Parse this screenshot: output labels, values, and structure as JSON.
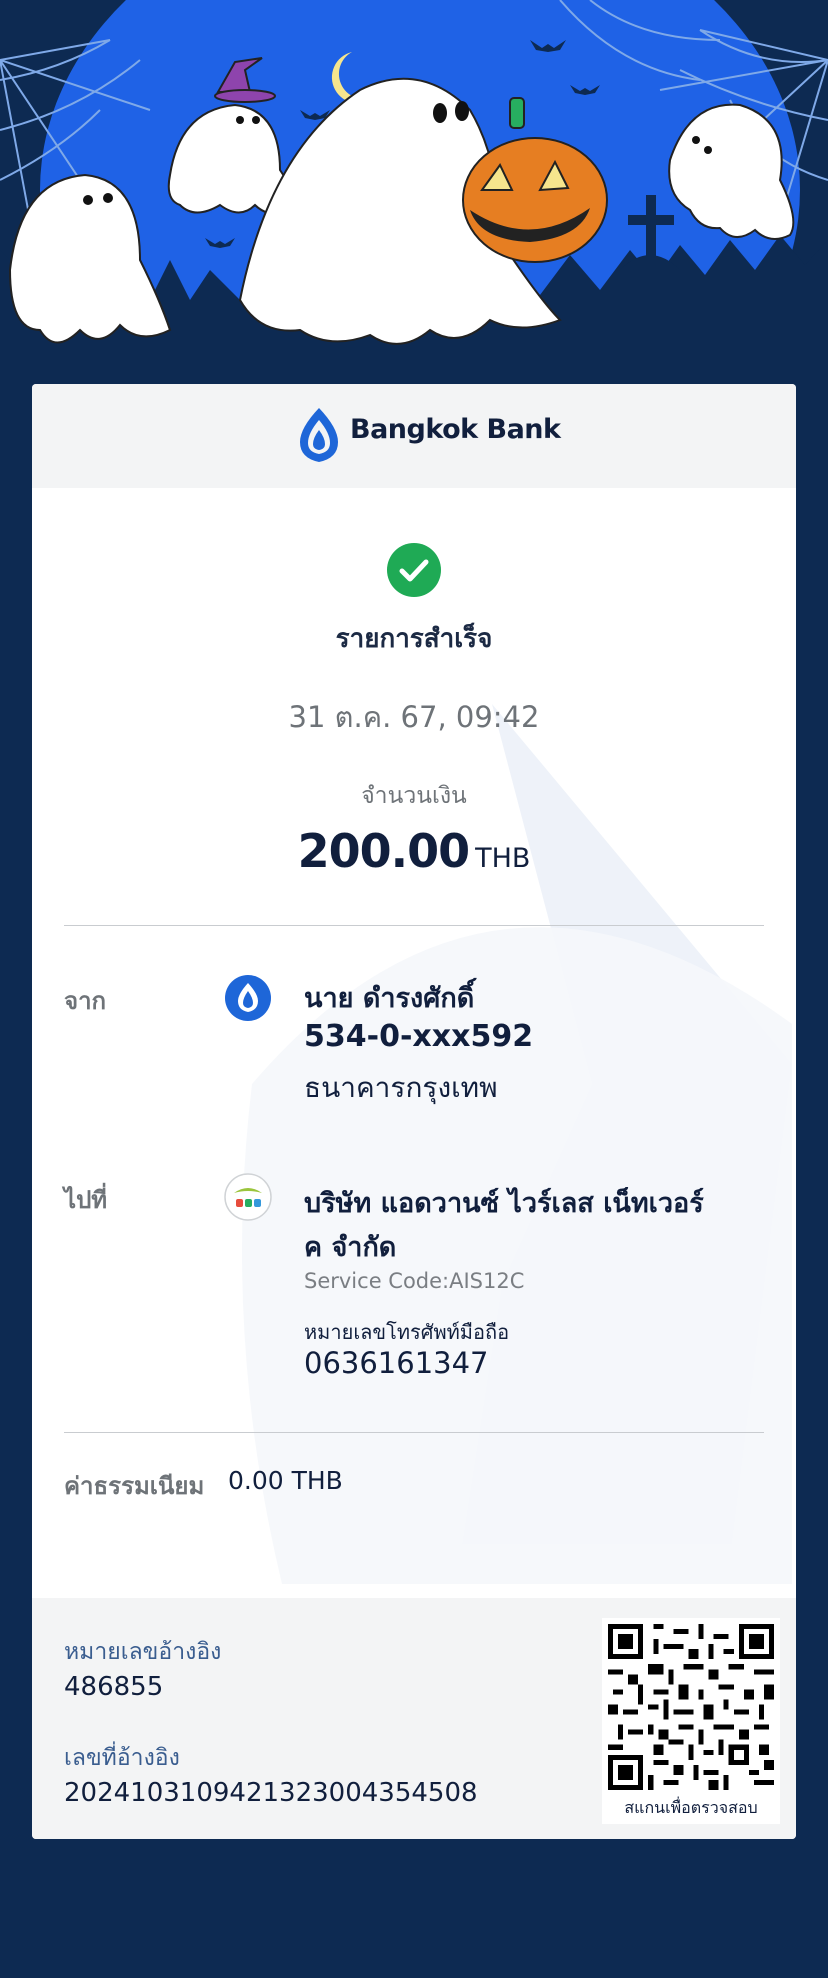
{
  "brand": {
    "name": "Bangkok Bank",
    "logo_icon": "bangkok-bank-lotus-icon",
    "color": "#1e66d8"
  },
  "status": {
    "icon": "check-circle-icon",
    "color": "#1faa55",
    "title": "รายการสำเร็จ"
  },
  "datetime": "31 ต.ค. 67, 09:42",
  "amount": {
    "label": "จำนวนเงิน",
    "value": "200.00",
    "unit": "THB"
  },
  "from": {
    "label": "จาก",
    "icon": "bangkok-bank-icon",
    "name": "นาย ดำรงศักดิ์",
    "account": "534-0-xxx592",
    "bank": "ธนาคารกรุงเทพ"
  },
  "to": {
    "label": "ไปที่",
    "icon": "ais-logo-icon",
    "name_line1": "บริษัท แอดวานซ์ ไวร์เลส เน็ทเวอร์",
    "name_line2": "ค จำกัด",
    "service_code": "Service Code:AIS12C",
    "phone_label": "หมายเลขโทรศัพท์มือถือ",
    "phone": "0636161347"
  },
  "fee": {
    "label": "ค่าธรรมเนียม",
    "value": "0.00 THB"
  },
  "reference": {
    "ref_no_label": "หมายเลขอ้างอิง",
    "ref_no": "486855",
    "ref_id_label": "เลขที่อ้างอิง",
    "ref_id": "2024103109421323004354508"
  },
  "qr": {
    "icon": "qr-code-icon",
    "caption": "สแกนเพื่อตรวจสอบ"
  },
  "banner": {
    "icon": "halloween-ghosts-illustration",
    "bg_color": "#1f62e6"
  },
  "page_bg": "#0d2a52"
}
